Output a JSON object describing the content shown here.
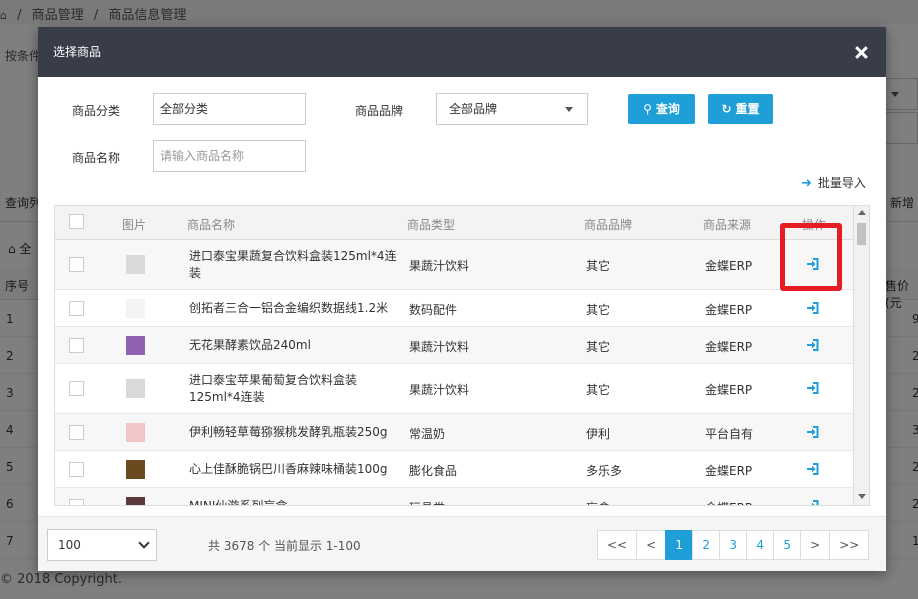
{
  "background": {
    "breadcrumb": [
      "/",
      "商品管理",
      "/",
      "商品信息管理"
    ],
    "filter_label": "按条件",
    "tab_left": "查询列",
    "tab_right": "新增",
    "home_label": "全",
    "col_index": "序号",
    "col_price": "售价(元",
    "rows": [
      {
        "n": "1",
        "r": "9"
      },
      {
        "n": "2",
        "r": "2"
      },
      {
        "n": "3",
        "r": "2"
      },
      {
        "n": "4",
        "r": "3"
      },
      {
        "n": "5",
        "r": "2"
      },
      {
        "n": "6",
        "r": "2"
      },
      {
        "n": "7",
        "r": "1"
      }
    ],
    "copyright": "© 2018 Copyright."
  },
  "modal": {
    "title": "选择商品",
    "filters": {
      "category_label": "商品分类",
      "category_value": "全部分类",
      "brand_label": "商品品牌",
      "brand_value": "全部品牌",
      "name_label": "商品名称",
      "name_placeholder": "请输入商品名称"
    },
    "buttons": {
      "search": "查询",
      "reset": "重置",
      "batch_import": "批量导入"
    },
    "table": {
      "headers": {
        "image": "图片",
        "name": "商品名称",
        "type": "商品类型",
        "brand": "商品品牌",
        "source": "商品来源",
        "action": "操作"
      },
      "rows": [
        {
          "name": "进口泰宝果蔬复合饮料盒装125ml*4连装",
          "type": "果蔬汁饮料",
          "brand": "其它",
          "source": "金蝶ERP",
          "thumb_color": "#d9d9d9"
        },
        {
          "name": "创拓者三合一铝合金编织数据线1.2米",
          "type": "数码配件",
          "brand": "其它",
          "source": "金蝶ERP",
          "thumb_color": "#f4f4f4"
        },
        {
          "name": "无花果酵素饮品240ml",
          "type": "果蔬汁饮料",
          "brand": "其它",
          "source": "金蝶ERP",
          "thumb_color": "#8e62b0"
        },
        {
          "name": "进口泰宝苹果葡萄复合饮料盒装125ml*4连装",
          "type": "果蔬汁饮料",
          "brand": "其它",
          "source": "金蝶ERP",
          "thumb_color": "#d9d9d9"
        },
        {
          "name": "伊利畅轻草莓猕猴桃发酵乳瓶装250g",
          "type": "常温奶",
          "brand": "伊利",
          "source": "平台自有",
          "thumb_color": "#f2c6c6"
        },
        {
          "name": "心上佳酥脆锅巴川香麻辣味桶装100g",
          "type": "膨化食品",
          "brand": "多乐多",
          "source": "金蝶ERP",
          "thumb_color": "#6b4a1f"
        },
        {
          "name": "MINI仙游系列盲盒",
          "type": "玩具类",
          "brand": "盲盒",
          "source": "金蝶ERP",
          "thumb_color": "#5a3a3a"
        }
      ]
    },
    "footer": {
      "page_size": "100",
      "info": "共 3678 个 当前显示 1-100",
      "pager": [
        "<<",
        "<",
        "1",
        "2",
        "3",
        "4",
        "5",
        ">",
        ">>"
      ],
      "active_page": "1"
    },
    "colors": {
      "header": "#393d49",
      "accent": "#1e9fd7",
      "highlight": "#e61c25"
    }
  }
}
